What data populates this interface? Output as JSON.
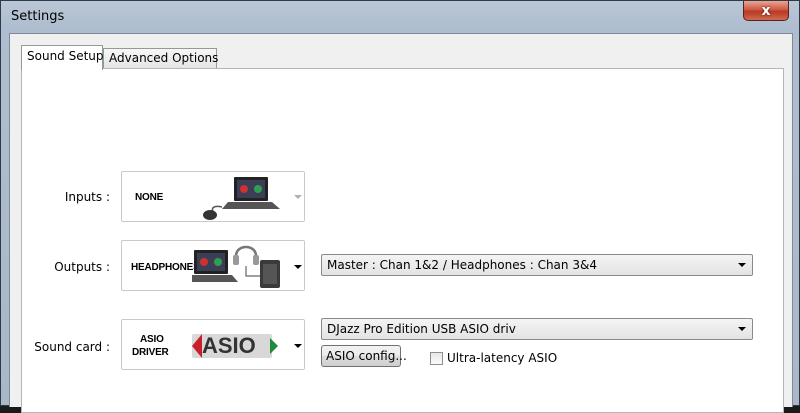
{
  "window": {
    "title": "Settings",
    "close_symbol": "x"
  },
  "tabs": [
    {
      "label": "Sound Setup",
      "active": true
    },
    {
      "label": "Advanced Options",
      "active": false
    }
  ],
  "inputs": {
    "label": "Inputs :",
    "image_tag": "NONE",
    "enabled": false
  },
  "outputs": {
    "label": "Outputs :",
    "image_tag": "HEADPHONES",
    "routing_value": "Master : Chan 1&2 / Headphones : Chan 3&4"
  },
  "sound_card": {
    "label": "Sound card :",
    "image_tag_line1": "ASIO",
    "image_tag_line2": "DRIVER",
    "logo_text": "ASIO",
    "device_value": "DJazz Pro Edition USB ASIO driv",
    "config_button": "ASIO config...",
    "ultra_latency_label": "Ultra-latency ASIO",
    "ultra_latency_checked": false
  },
  "colors": {
    "asio_red": "#c8202a",
    "asio_green": "#1f8a3a"
  }
}
